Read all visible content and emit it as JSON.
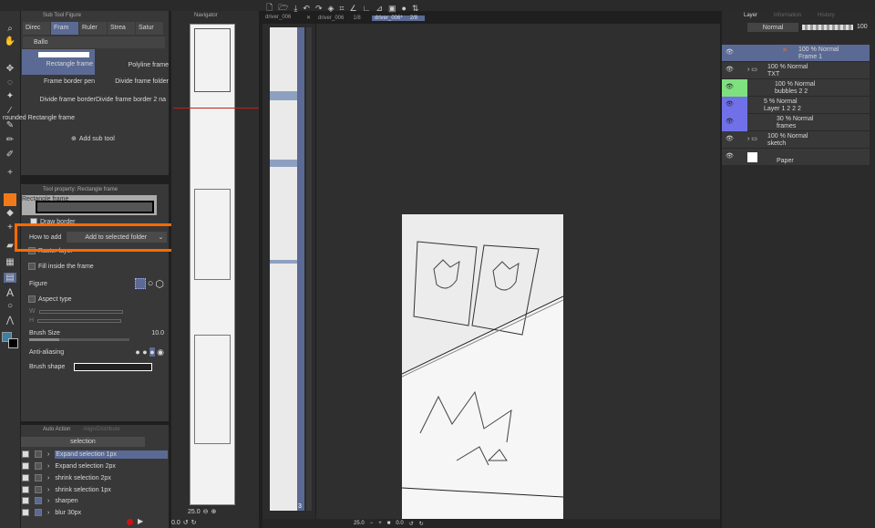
{
  "subtool": {
    "panel_title": "Sub Tool Figure",
    "tabs": [
      "Direc",
      "Fram",
      "Ruler",
      "Strea",
      "Satur",
      "Ballo"
    ],
    "items": [
      "Rectangle frame",
      "Polyline frame",
      "Frame border pen",
      "Divide frame folder",
      "Divide frame border",
      "Divide frame border 2 na",
      "rounded Rectangle frame"
    ],
    "add": "Add sub tool"
  },
  "toolprop": {
    "panel_title": "Tool property: Rectangle frame",
    "preview_label": "Rectangle frame",
    "draw_border": "Draw border",
    "how_to_add_label": "How to add",
    "how_to_add_value": "Add to selected folder",
    "raster_layer": "Raster layer",
    "fill_inside": "Fill inside the frame",
    "figure": "Figure",
    "aspect_type": "Aspect type",
    "w": "W",
    "h": "H",
    "brush_size": "Brush Size",
    "brush_size_value": "10.0",
    "anti_aliasing": "Anti-aliasing",
    "brush_shape": "Brush shape"
  },
  "autoaction": {
    "tab1": "Auto Action",
    "tab2": "Align/Distribute",
    "set": "selection",
    "items": [
      "Expand selection 1px",
      "Expand selection 2px",
      "shrink selection 2px",
      "shrink selection 1px",
      "sharpen",
      "blur 30px"
    ]
  },
  "navigator": {
    "title": "Navigator",
    "zoom": "25.0",
    "angle": "0.0"
  },
  "tabs": [
    {
      "label": "driver_006",
      "page": ""
    },
    {
      "label": "driver_006",
      "page": "1/8"
    },
    {
      "label": "driver_006*",
      "page": "2/8"
    }
  ],
  "pages": {
    "num": "3"
  },
  "status": {
    "zoom": "25.0",
    "angle": "0.0"
  },
  "layers": {
    "tabs": [
      "Layer",
      "Information",
      "History"
    ],
    "blend": "Normal",
    "opacity": "100",
    "items": [
      {
        "info": "100 % Normal",
        "name": "Frame 1"
      },
      {
        "info": "100 % Normal",
        "name": "TXT"
      },
      {
        "info": "100 % Normal",
        "name": "bubbles 2 2"
      },
      {
        "info": "5 % Normal",
        "name": "Layer 1 2 2 2"
      },
      {
        "info": "30 % Normal",
        "name": "frames"
      },
      {
        "info": "100 % Normal",
        "name": "sketch"
      },
      {
        "info": "",
        "name": "Paper"
      }
    ]
  },
  "colors": {
    "accent": "#5a6a94",
    "highlight": "#ff6a00",
    "green": "#7fe07f",
    "purple": "#7070e8"
  }
}
